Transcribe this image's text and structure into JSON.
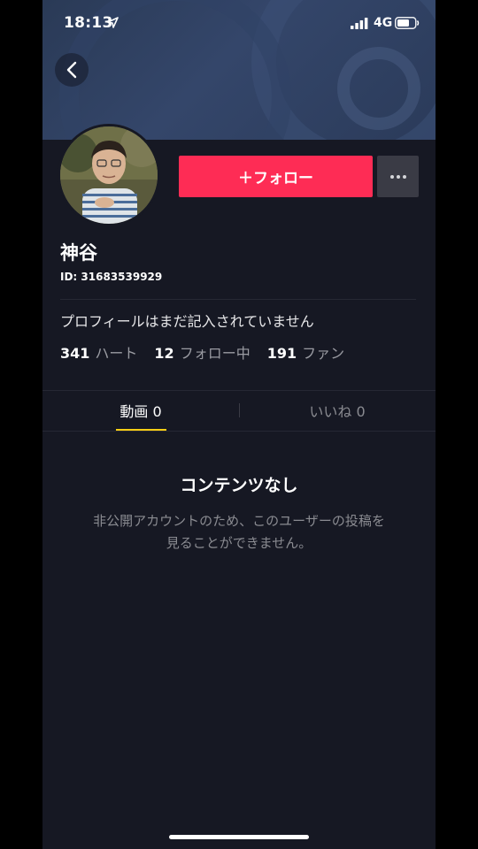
{
  "status_bar": {
    "time": "18:13",
    "network": "4G"
  },
  "profile": {
    "display_name": "神谷",
    "user_id": "ID: 31683539929",
    "bio": "プロフィールはまだ記入されていません",
    "follow_label": "＋フォロー",
    "more_icon": "more-dots-icon"
  },
  "stats": [
    {
      "value": "341",
      "label": "ハート"
    },
    {
      "value": "12",
      "label": "フォロー中"
    },
    {
      "value": "191",
      "label": "ファン"
    }
  ],
  "tabs": [
    {
      "label": "動画 0",
      "active": true
    },
    {
      "label": "いいね 0",
      "active": false
    }
  ],
  "empty_state": {
    "title": "コンテンツなし",
    "line1": "非公開アカウントのため、このユーザーの投稿を",
    "line2": "見ることができません。"
  },
  "colors": {
    "background": "#161823",
    "follow_button": "#fe2c55",
    "tab_indicator": "#face15",
    "secondary_text": "#8a8b91"
  }
}
